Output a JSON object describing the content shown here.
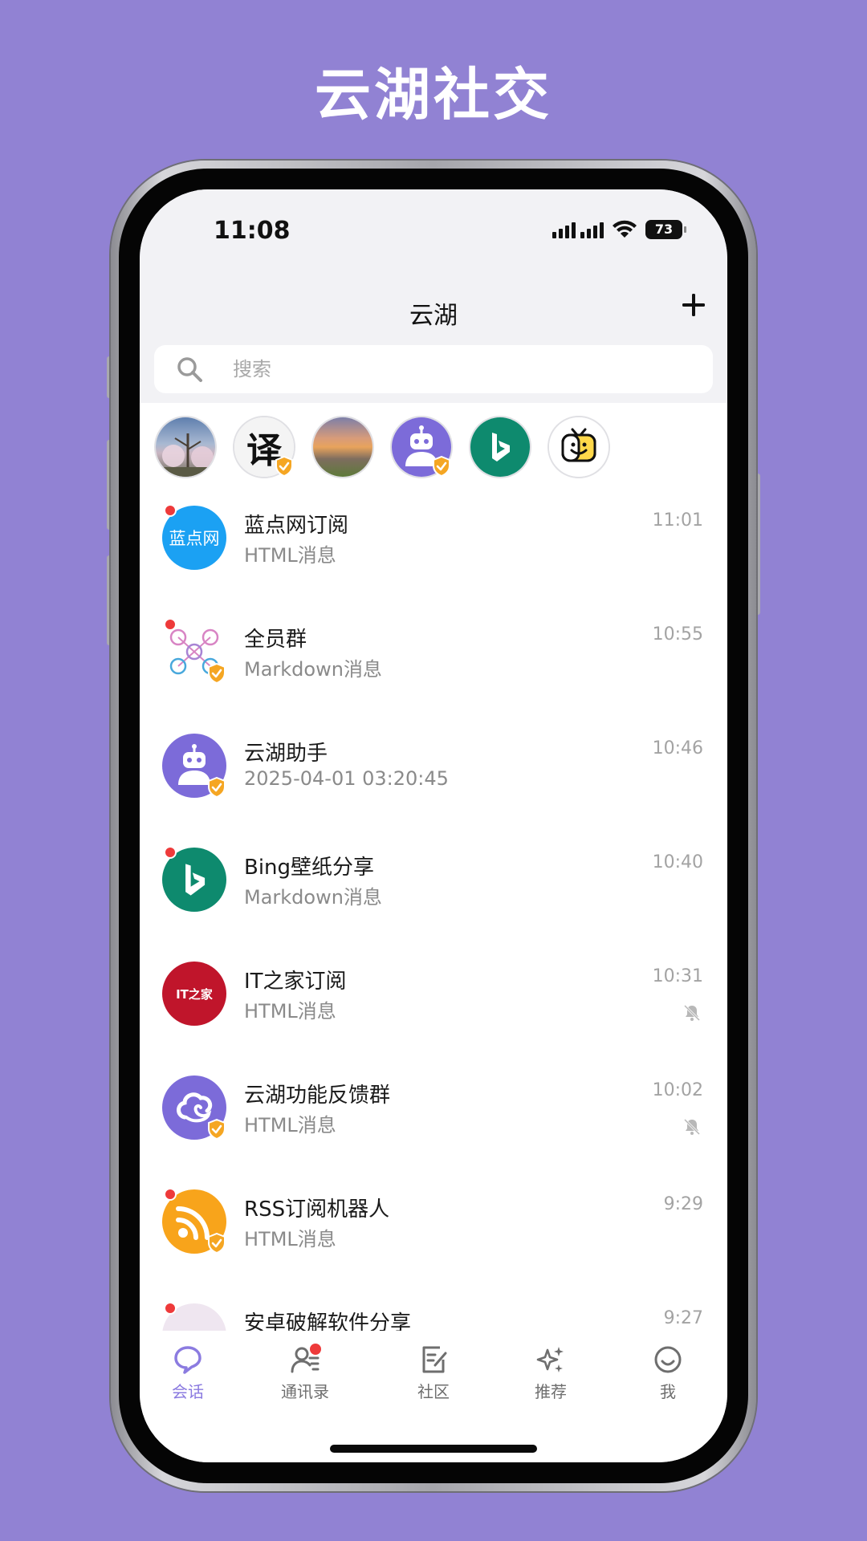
{
  "promo": {
    "title": "云湖社交"
  },
  "status_bar": {
    "time": "11:08",
    "battery": "73"
  },
  "header": {
    "title": "云湖"
  },
  "search": {
    "placeholder": "搜索"
  },
  "stories": [
    {
      "name": "blossom-tree-avatar",
      "badge": false
    },
    {
      "name": "translate-avatar",
      "text": "译",
      "badge": true
    },
    {
      "name": "sunset-avatar",
      "badge": false
    },
    {
      "name": "robot-avatar",
      "badge": true
    },
    {
      "name": "bing-avatar",
      "badge": false
    },
    {
      "name": "tv-smile-avatar",
      "badge": false
    }
  ],
  "chats": [
    {
      "name": "蓝点网订阅",
      "subtitle": "HTML消息",
      "time": "11:01",
      "unread": true,
      "verified": false,
      "muted": false,
      "avatar_text": "蓝点网",
      "avatar_color": "#1BA1F3"
    },
    {
      "name": "全员群",
      "subtitle": "Markdown消息",
      "time": "10:55",
      "unread": true,
      "verified": true,
      "muted": false
    },
    {
      "name": "云湖助手",
      "subtitle": "2025-04-01 03:20:45",
      "time": "10:46",
      "unread": false,
      "verified": true,
      "muted": false,
      "avatar_color": "#7C6BD9"
    },
    {
      "name": "Bing壁纸分享",
      "subtitle": "Markdown消息",
      "time": "10:40",
      "unread": true,
      "verified": false,
      "muted": false,
      "avatar_color": "#0E8A6E"
    },
    {
      "name": "IT之家订阅",
      "subtitle": "HTML消息",
      "time": "10:31",
      "unread": false,
      "verified": false,
      "muted": true,
      "avatar_text": "IT之家",
      "avatar_color": "#C0152B"
    },
    {
      "name": "云湖功能反馈群",
      "subtitle": "HTML消息",
      "time": "10:02",
      "unread": false,
      "verified": true,
      "muted": true,
      "avatar_color": "#7C6BD9"
    },
    {
      "name": "RSS订阅机器人",
      "subtitle": "HTML消息",
      "time": "9:29",
      "unread": true,
      "verified": true,
      "muted": false,
      "avatar_color": "#F8A41B"
    },
    {
      "name": "安卓破解软件分享",
      "subtitle": "",
      "time": "9:27",
      "unread": true,
      "verified": false,
      "muted": false
    }
  ],
  "tabs": [
    {
      "label": "会话",
      "active": true
    },
    {
      "label": "通讯录",
      "active": false,
      "dot": true
    },
    {
      "label": "社区",
      "active": false
    },
    {
      "label": "推荐",
      "active": false
    },
    {
      "label": "我",
      "active": false
    }
  ],
  "colors": {
    "background": "#9182D3",
    "accent": "#8B7BE0",
    "unread": "#EE3A3A",
    "verified": "#F5A623"
  }
}
